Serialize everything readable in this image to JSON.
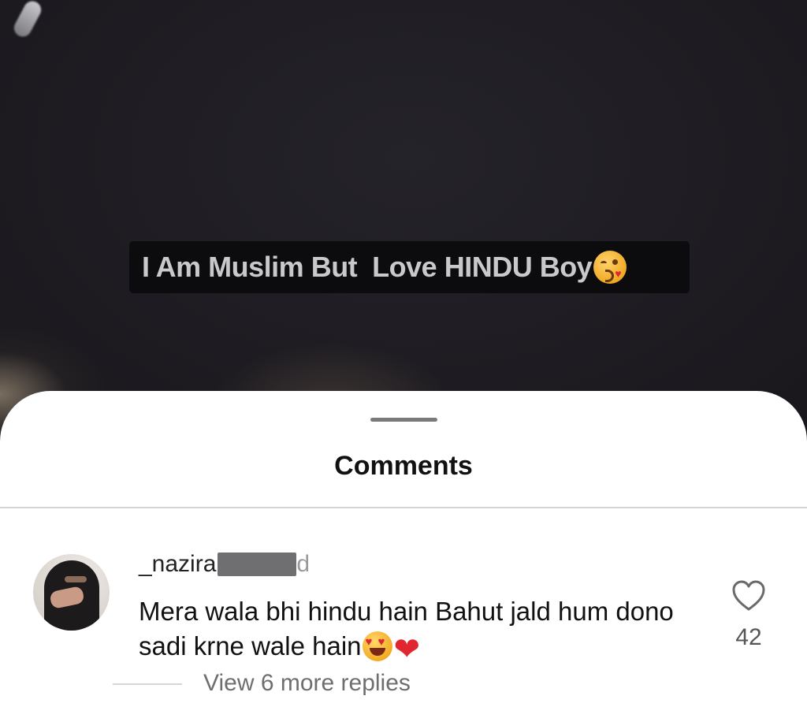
{
  "video": {
    "caption": "I Am Muslim But  Love HINDU Boy",
    "caption_emoji": "face-blowing-kiss-emoji"
  },
  "sheet": {
    "title": "Comments"
  },
  "comments": [
    {
      "username": "_nazira",
      "username_tail": "d",
      "text": "Mera wala bhi hindu hain Bahut jald hum dono sadi krne wale hain",
      "emojis": [
        "smiling-face-with-heart-eyes-emoji",
        "red-heart-emoji"
      ],
      "like_count": "42",
      "like_icon": "heart-outline-icon",
      "replies_label": "View 6 more replies"
    }
  ],
  "colors": {
    "video_background": "#1a181d",
    "sheet_background": "#ffffff",
    "caption_background": "#0c0b0d",
    "caption_text": "#c9c9cc",
    "secondary_text": "#6e6e6e"
  }
}
